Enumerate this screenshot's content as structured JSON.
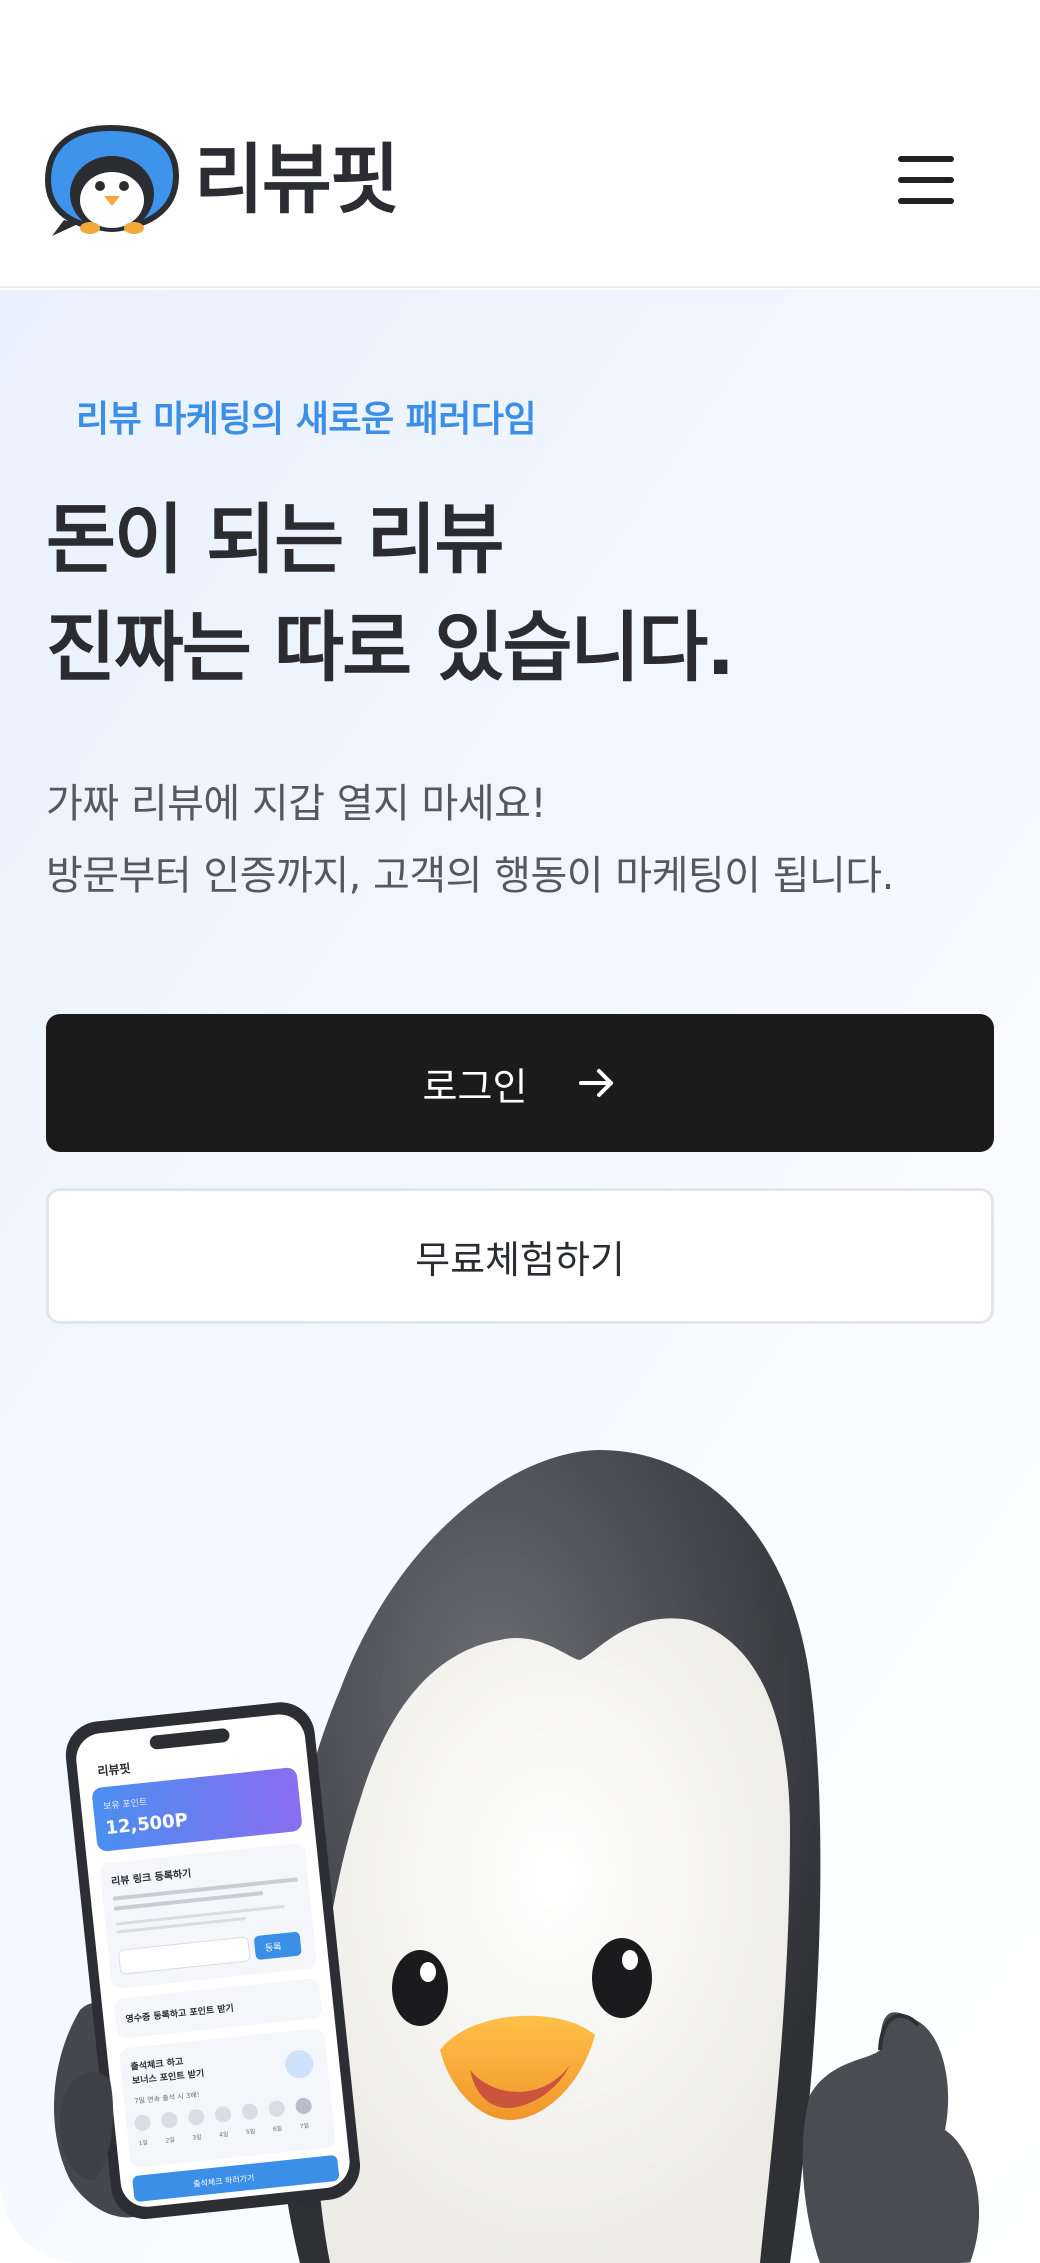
{
  "header": {
    "logo_text": "리뷰핏",
    "menu_icon": "hamburger-menu-icon"
  },
  "hero": {
    "tagline": "리뷰 마케팅의 새로운 패러다임",
    "headline_line1": "돈이 되는 리뷰",
    "headline_line2": "진짜는 따로 있습니다.",
    "subcopy_line1": "가짜 리뷰에 지갑 열지 마세요!",
    "subcopy_line2": "방문부터 인증까지, 고객의 행동이 마케팅이 됩니다.",
    "login_label": "로그인",
    "login_icon": "arrow-right-icon",
    "trial_label": "무료체험하기"
  },
  "phone": {
    "app_name": "리뷰핏",
    "points_label": "보유 포인트",
    "points_value": "12,500P",
    "card1_title": "리뷰 링크 등록하기",
    "card1_button": "등록",
    "card2_title": "영수증 등록하고 포인트 받기",
    "card3_title_line1": "출석체크 하고",
    "card3_title_line2": "보너스 포인트 받기",
    "card3_sub": "7일 연속 출석 시 3배!",
    "days": [
      "1일",
      "2일",
      "3일",
      "4일",
      "5일",
      "6일",
      "7일"
    ],
    "bottom_button": "출석체크 하러가기"
  },
  "colors": {
    "accent": "#3b8fe6",
    "primary_button": "#1b1b1b",
    "headline": "#2a2c31"
  }
}
